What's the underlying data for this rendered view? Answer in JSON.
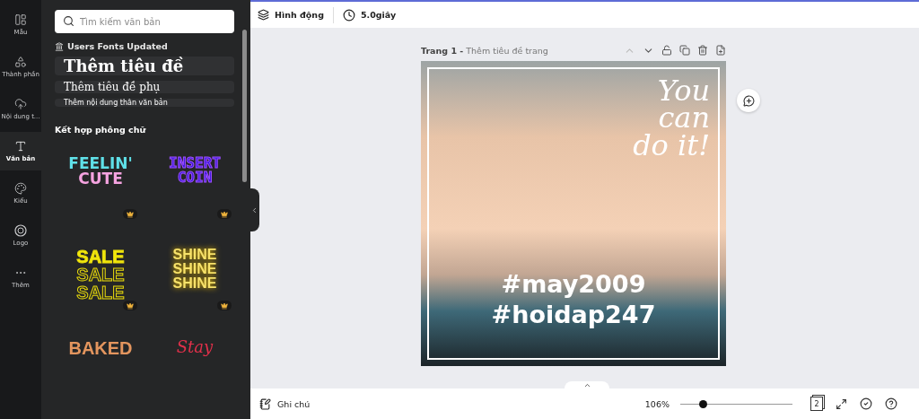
{
  "rail": [
    {
      "label": "Mẫu",
      "kind": "layout",
      "selected": false
    },
    {
      "label": "Thành phần",
      "kind": "shapes",
      "selected": false
    },
    {
      "label": "Nội dung t...",
      "kind": "upload",
      "selected": false
    },
    {
      "label": "Văn bản",
      "kind": "text",
      "selected": true
    },
    {
      "label": "Kiểu",
      "kind": "palette",
      "selected": false
    },
    {
      "label": "Logo",
      "kind": "logo",
      "selected": false
    },
    {
      "label": "Thêm",
      "kind": "more",
      "selected": false
    }
  ],
  "panel": {
    "search": {
      "placeholder": "Tìm kiếm văn bản"
    },
    "fonts_note": "Users Fonts Updated",
    "text_presets": [
      {
        "kind": "heading",
        "label": "Thêm tiêu đề"
      },
      {
        "kind": "subheading",
        "label": "Thêm tiêu đề phụ"
      },
      {
        "kind": "body",
        "label": "Thêm nội dung thân văn bản"
      }
    ],
    "section_title": "Kết hợp phông chữ",
    "combos": [
      {
        "kind": "feelin",
        "lines": [
          "FEELIN'",
          "CUTE"
        ],
        "premium": true
      },
      {
        "kind": "insert",
        "lines": [
          "INSERT",
          "COIN"
        ],
        "premium": true
      },
      {
        "kind": "sale",
        "lines": [
          "SALE",
          "SALE",
          "SALE"
        ],
        "premium": true
      },
      {
        "kind": "shine",
        "lines": [
          "SHINE",
          "SHINE",
          "SHINE"
        ],
        "premium": true
      },
      {
        "kind": "baked",
        "lines": [
          "BAKED"
        ],
        "premium": false
      },
      {
        "kind": "stay",
        "lines": [
          "Stay"
        ],
        "premium": false
      }
    ]
  },
  "toolbar": {
    "animate": "Hình động",
    "duration": "5.0giây"
  },
  "page": {
    "number": "Trang 1 -",
    "title": "Thêm tiêu đề trang",
    "design": {
      "script_lines": [
        "You",
        "can",
        "do it!"
      ],
      "hashtags": [
        "#may2009",
        "#hoidap247"
      ]
    }
  },
  "status_bar": {
    "notes": "Ghi chú",
    "zoom": "106%",
    "level": 0.2,
    "pages": "2"
  }
}
